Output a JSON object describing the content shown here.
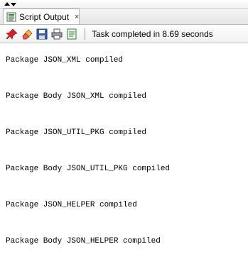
{
  "tab": {
    "label": "Script Output",
    "close": "×"
  },
  "toolbar": {
    "buttons": [
      "pin-icon",
      "eraser-icon",
      "save-icon",
      "print-icon",
      "open-file-icon"
    ],
    "status": "Task completed in 8.69 seconds"
  },
  "output": {
    "lines": [
      "Package JSON_XML compiled",
      "Package Body JSON_XML compiled",
      "Package JSON_UTIL_PKG compiled",
      "Package Body JSON_UTIL_PKG compiled",
      "Package JSON_HELPER compiled",
      "Package Body JSON_HELPER compiled"
    ]
  },
  "colors": {
    "accent": "#4a7fc1",
    "pin": "#d42020",
    "eraser": "#e8a23a"
  }
}
